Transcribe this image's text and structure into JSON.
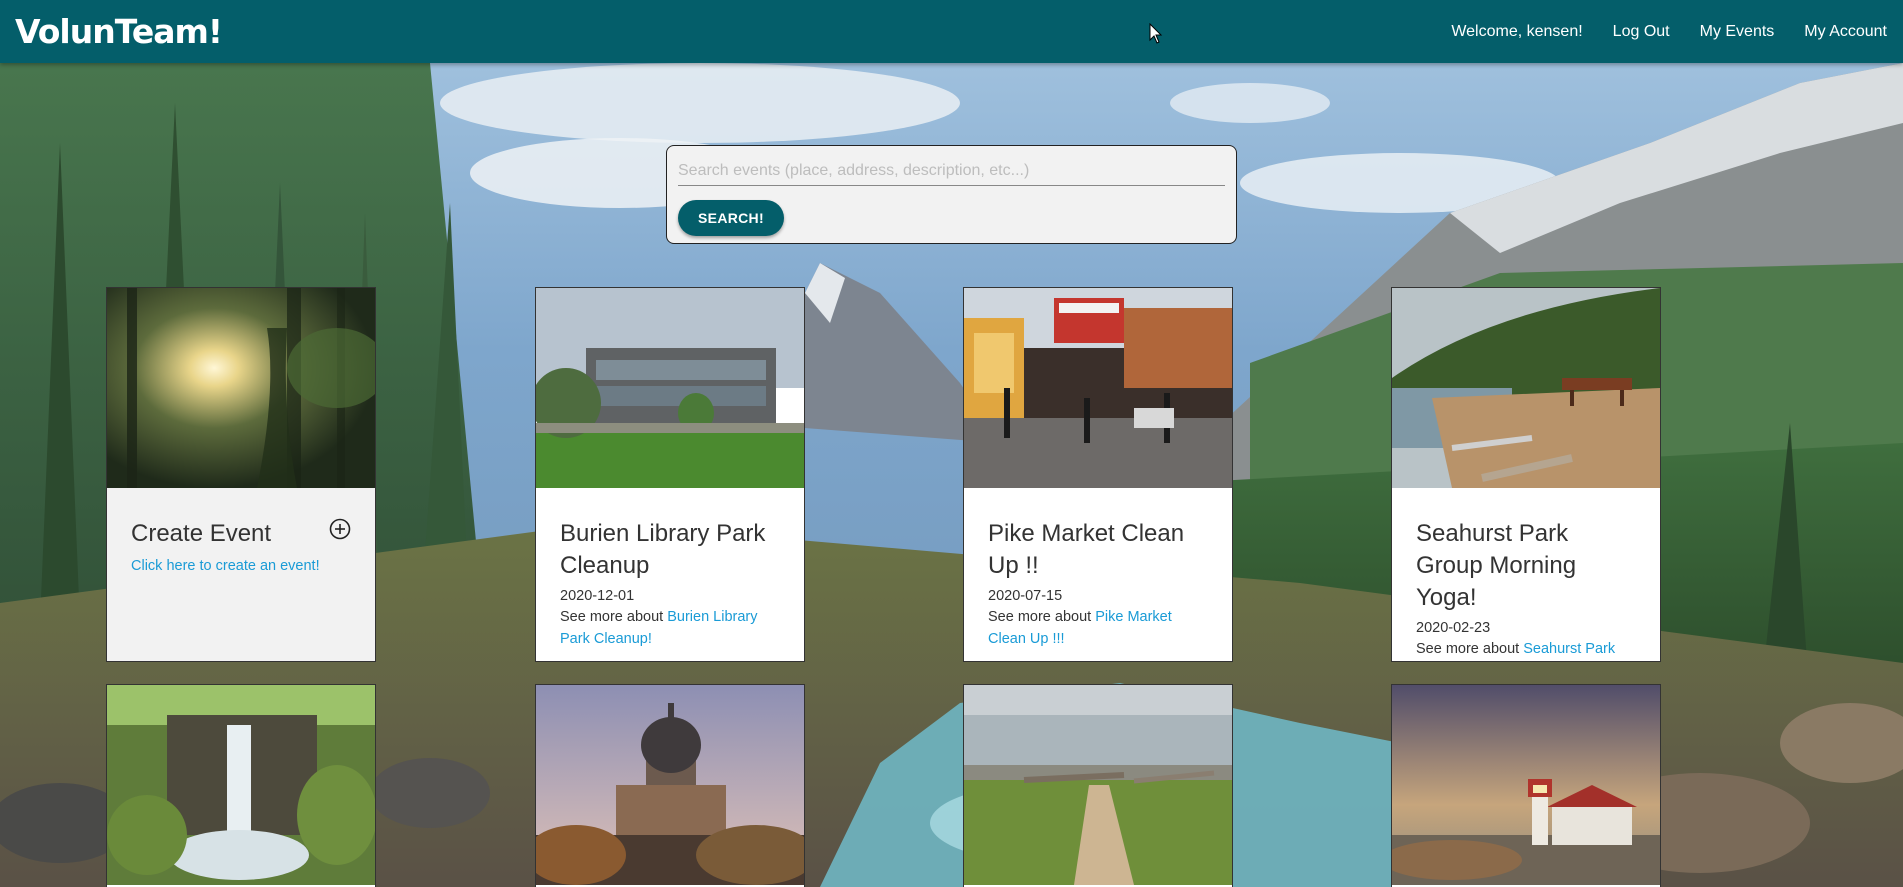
{
  "navbar": {
    "brand": "VolunTeam!",
    "welcome": "Welcome, kensen!",
    "logout": "Log Out",
    "my_events": "My Events",
    "my_account": "My Account"
  },
  "search": {
    "placeholder": "Search events (place, address, description, etc...)",
    "value": "",
    "button": "SEARCH!"
  },
  "create_card": {
    "title": "Create Event",
    "link": "Click here to create an event!",
    "icon": "add-circle-icon"
  },
  "events": [
    {
      "title": "Burien Library Park Cleanup",
      "date": "2020-12-01",
      "more_prefix": "See more about ",
      "link": "Burien Library Park Cleanup!"
    },
    {
      "title": "Pike Market Clean Up !!",
      "date": "2020-07-15",
      "more_prefix": "See more about ",
      "link": "Pike Market Clean Up !!!"
    },
    {
      "title": "Seahurst Park Group Morning Yoga!",
      "date": "2020-02-23",
      "more_prefix": "See more about ",
      "link": "Seahurst Park Group Morning Yoga!!"
    }
  ],
  "colors": {
    "primary": "#045e6a",
    "link": "#1a9bd6"
  }
}
